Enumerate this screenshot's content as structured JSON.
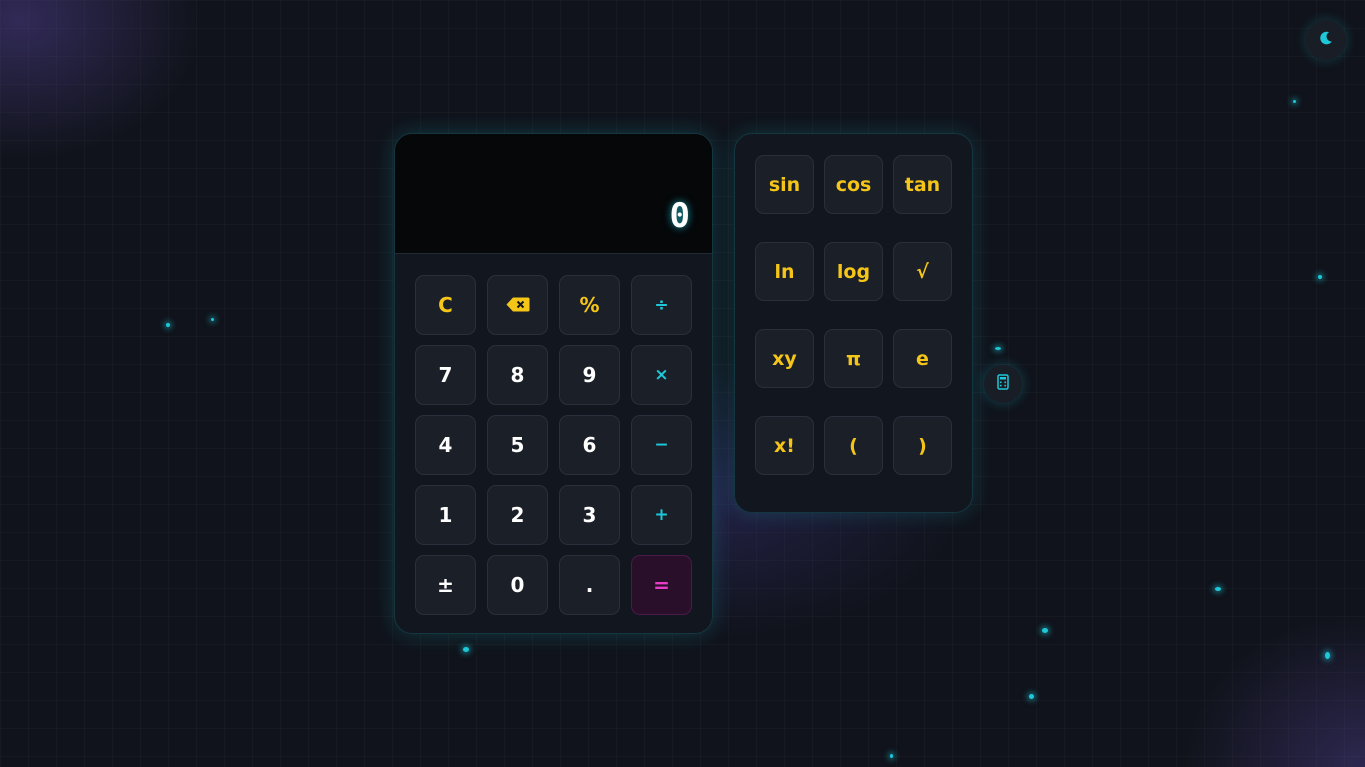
{
  "theme_toggle": {
    "icon": "moon-icon"
  },
  "display": {
    "value": "0"
  },
  "keypad": {
    "rows": [
      [
        {
          "label": "C",
          "kind": "fn"
        },
        {
          "label": "⌫",
          "kind": "fn",
          "icon": "backspace-icon"
        },
        {
          "label": "%",
          "kind": "fn"
        },
        {
          "label": "÷",
          "kind": "op"
        }
      ],
      [
        {
          "label": "7",
          "kind": "num"
        },
        {
          "label": "8",
          "kind": "num"
        },
        {
          "label": "9",
          "kind": "num"
        },
        {
          "label": "×",
          "kind": "op"
        }
      ],
      [
        {
          "label": "4",
          "kind": "num"
        },
        {
          "label": "5",
          "kind": "num"
        },
        {
          "label": "6",
          "kind": "num"
        },
        {
          "label": "−",
          "kind": "op"
        }
      ],
      [
        {
          "label": "1",
          "kind": "num"
        },
        {
          "label": "2",
          "kind": "num"
        },
        {
          "label": "3",
          "kind": "num"
        },
        {
          "label": "+",
          "kind": "op"
        }
      ],
      [
        {
          "label": "±",
          "kind": "num"
        },
        {
          "label": "0",
          "kind": "num"
        },
        {
          "label": ".",
          "kind": "num"
        },
        {
          "label": "=",
          "kind": "eq"
        }
      ]
    ]
  },
  "scientific": {
    "keys": [
      "sin",
      "cos",
      "tan",
      "ln",
      "log",
      "√",
      "xy",
      "π",
      "e",
      "x!",
      "(",
      ")"
    ]
  },
  "scientific_toggle": {
    "icon": "calculator-icon"
  },
  "colors": {
    "accent_cyan": "#1ec8d8",
    "accent_yellow": "#f5c518",
    "accent_magenta": "#e83cc8",
    "background": "#10131b",
    "panel": "#12161e",
    "key": "#1b1f28"
  }
}
